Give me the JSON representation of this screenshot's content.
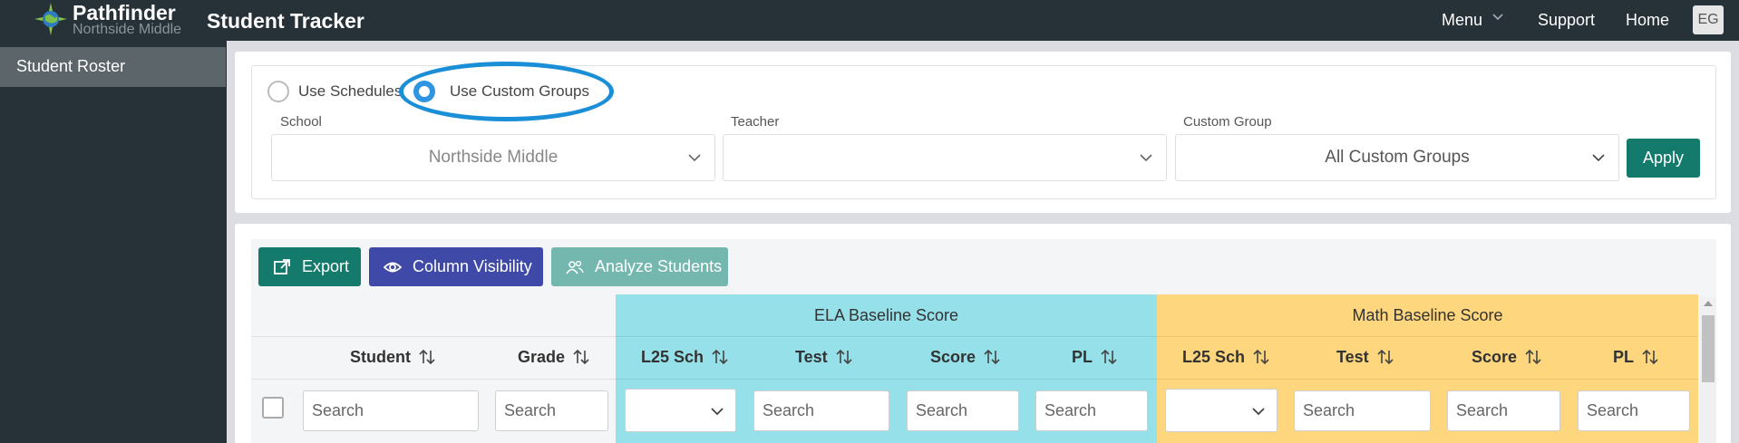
{
  "header": {
    "brand_name": "Pathfinder",
    "brand_school": "Northside Middle",
    "app_title": "Student Tracker",
    "nav": {
      "menu": "Menu",
      "support": "Support",
      "home": "Home"
    },
    "avatar_initials": "EG"
  },
  "sidebar": {
    "items": [
      {
        "label": "Student Roster",
        "active": true
      }
    ]
  },
  "filters": {
    "mode_options": [
      {
        "label": "Use Schedules",
        "checked": false
      },
      {
        "label": "Use Custom Groups",
        "checked": true
      }
    ],
    "school": {
      "label": "School",
      "value": "Northside Middle"
    },
    "teacher": {
      "label": "Teacher",
      "value": ""
    },
    "custom_group": {
      "label": "Custom Group",
      "value": "All Custom Groups"
    },
    "apply_label": "Apply"
  },
  "toolbar": {
    "export": "Export",
    "column_visibility": "Column Visibility",
    "analyze_students": "Analyze Students"
  },
  "table": {
    "groups": [
      {
        "label": "ELA Baseline Score",
        "color": "#96e0ea"
      },
      {
        "label": "Math Baseline Score",
        "color": "#fdd67d"
      }
    ],
    "columns": [
      "Student",
      "Grade",
      "L25 Sch",
      "Test",
      "Score",
      "PL",
      "L25 Sch",
      "Test",
      "Score",
      "PL"
    ],
    "search_placeholder": "Search"
  },
  "colors": {
    "topbar": "#263238",
    "primary_teal": "#147a6c",
    "indigo": "#3f4aa8",
    "light_teal": "#74b7ae",
    "radio_accent": "#2f95e0"
  }
}
